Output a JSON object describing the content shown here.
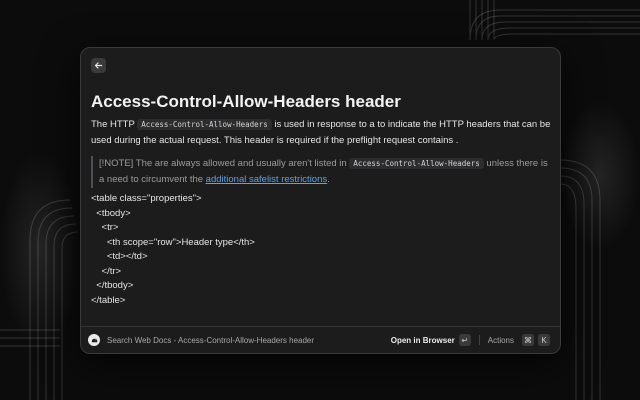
{
  "doc": {
    "title": "Access-Control-Allow-Headers header",
    "intro_prefix": "The HTTP ",
    "intro_code": "Access-Control-Allow-Headers",
    "intro_suffix": " is used in response to a  to indicate the HTTP headers that can be used during the actual request. This header is required if the preflight request contains .",
    "note_prefix": "[!NOTE] The  are always allowed and usually aren't listed in ",
    "note_code": "Access-Control-Allow-Headers",
    "note_suffix": " unless there is a need to circumvent the ",
    "note_link": "additional safelist restrictions",
    "note_end": ".",
    "code_lines": [
      "<table class=\"properties\">",
      "  <tbody>",
      "    <tr>",
      "      <th scope=\"row\">Header type</th>",
      "      <td></td>",
      "    </tr>",
      "  </tbody>",
      "</table>"
    ]
  },
  "footer": {
    "nav_title": "Search Web Docs - Access-Control-Allow-Headers header",
    "open_label": "Open in Browser",
    "open_key": "↵",
    "actions_label": "Actions",
    "actions_key_mod": "⌘",
    "actions_key": "K"
  },
  "icons": {
    "back": "arrow-left-icon",
    "app": "extension-icon"
  },
  "colors": {
    "background": "#0c0c0c",
    "window": "#1c1c1d",
    "link": "#5aa3e8"
  }
}
